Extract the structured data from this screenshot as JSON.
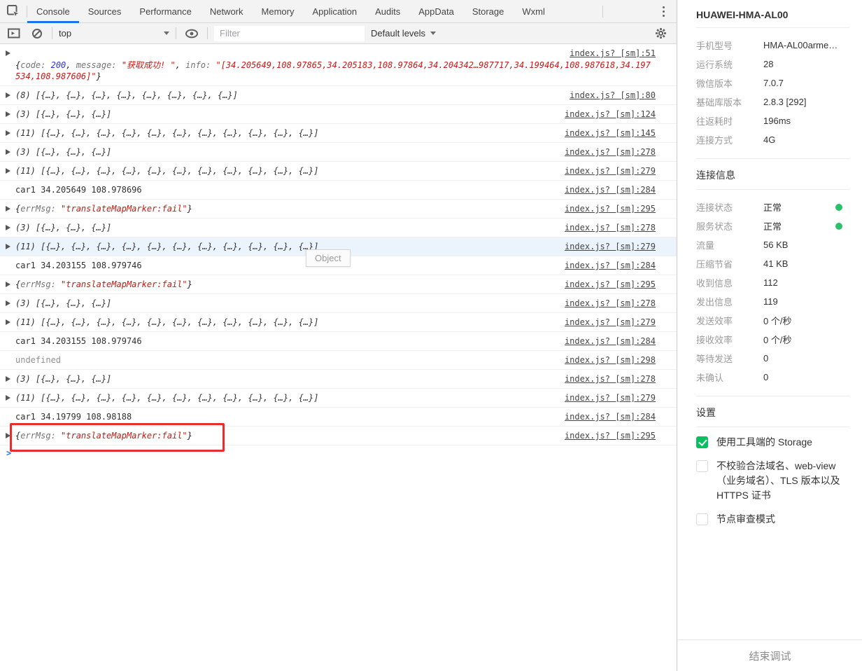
{
  "colors": {
    "accent_blue": "#1a73e8",
    "link": "#454545",
    "string_red": "#c41a16",
    "number_blue": "#2b33cc",
    "highlight_row": "#ebf3fc",
    "annotation_red": "#e52e2e",
    "status_green": "#2bc06a",
    "checkbox_green": "#07c160",
    "toolbar_bg": "#f3f3f3"
  },
  "tabs": {
    "items": [
      "Console",
      "Sources",
      "Performance",
      "Network",
      "Memory",
      "Application",
      "Audits",
      "AppData",
      "Storage",
      "Wxml"
    ],
    "active": "Console"
  },
  "toolbar": {
    "context_label": "top",
    "filter_placeholder": "Filter",
    "levels_label": "Default levels"
  },
  "icons": [
    "inspect-icon",
    "kebab-menu-icon",
    "drawer-toggle-icon",
    "clear-console-icon",
    "live-expression-eye-icon",
    "gear-icon",
    "chevron-down-icon"
  ],
  "console": {
    "tooltip": "Object",
    "prompt": ">",
    "rows": [
      {
        "kind": "object",
        "wrap": true,
        "link": "index.js? [sm]:51",
        "segments": [
          {
            "t": "{",
            "s": "b"
          },
          {
            "t": "code: ",
            "s": "k"
          },
          {
            "t": "200",
            "s": "n"
          },
          {
            "t": ", ",
            "s": "b"
          },
          {
            "t": "message: ",
            "s": "k"
          },
          {
            "t": "\"获取成功! \"",
            "s": "s"
          },
          {
            "t": ", ",
            "s": "b"
          },
          {
            "t": "info: ",
            "s": "k"
          },
          {
            "t": "\"[34.205649,108.97865,34.205183,108.97864,34.204342…987717,34.199464,108.987618,34.197534,108.987606]\"",
            "s": "s"
          },
          {
            "t": "}",
            "s": "b"
          }
        ]
      },
      {
        "kind": "preview",
        "link": "index.js? [sm]:80",
        "text": "(8) [{…}, {…}, {…}, {…}, {…}, {…}, {…}, {…}]"
      },
      {
        "kind": "preview",
        "link": "index.js? [sm]:124",
        "text": "(3) [{…}, {…}, {…}]"
      },
      {
        "kind": "preview",
        "link": "index.js? [sm]:145",
        "text": "(11) [{…}, {…}, {…}, {…}, {…}, {…}, {…}, {…}, {…}, {…}, {…}]"
      },
      {
        "kind": "preview",
        "link": "index.js? [sm]:278",
        "text": "(3) [{…}, {…}, {…}]"
      },
      {
        "kind": "preview",
        "link": "index.js? [sm]:279",
        "text": "(11) [{…}, {…}, {…}, {…}, {…}, {…}, {…}, {…}, {…}, {…}, {…}]"
      },
      {
        "kind": "log",
        "link": "index.js? [sm]:284",
        "text": "car1 34.205649 108.978696"
      },
      {
        "kind": "object",
        "link": "index.js? [sm]:295",
        "segments": [
          {
            "t": "{",
            "s": "b"
          },
          {
            "t": "errMsg: ",
            "s": "k"
          },
          {
            "t": "\"translateMapMarker:fail\"",
            "s": "s"
          },
          {
            "t": "}",
            "s": "b"
          }
        ]
      },
      {
        "kind": "preview",
        "link": "index.js? [sm]:278",
        "text": "(3) [{…}, {…}, {…}]"
      },
      {
        "kind": "preview",
        "link": "index.js? [sm]:279",
        "highlight": true,
        "text": "(11) [{…}, {…}, {…}, {…}, {…}, {…}, {…}, {…}, {…}, {…}, {…}]"
      },
      {
        "kind": "log",
        "link": "index.js? [sm]:284",
        "text": "car1 34.203155 108.979746"
      },
      {
        "kind": "object",
        "link": "index.js? [sm]:295",
        "segments": [
          {
            "t": "{",
            "s": "b"
          },
          {
            "t": "errMsg: ",
            "s": "k"
          },
          {
            "t": "\"translateMapMarker:fail\"",
            "s": "s"
          },
          {
            "t": "}",
            "s": "b"
          }
        ]
      },
      {
        "kind": "preview",
        "link": "index.js? [sm]:278",
        "text": "(3) [{…}, {…}, {…}]"
      },
      {
        "kind": "preview",
        "link": "index.js? [sm]:279",
        "text": "(11) [{…}, {…}, {…}, {…}, {…}, {…}, {…}, {…}, {…}, {…}, {…}]"
      },
      {
        "kind": "log",
        "link": "index.js? [sm]:284",
        "text": "car1 34.203155 108.979746"
      },
      {
        "kind": "undefined",
        "link": "index.js? [sm]:298",
        "text": "undefined"
      },
      {
        "kind": "preview",
        "link": "index.js? [sm]:278",
        "text": "(3) [{…}, {…}, {…}]"
      },
      {
        "kind": "preview",
        "link": "index.js? [sm]:279",
        "text": "(11) [{…}, {…}, {…}, {…}, {…}, {…}, {…}, {…}, {…}, {…}, {…}]"
      },
      {
        "kind": "log",
        "link": "index.js? [sm]:284",
        "text": "car1 34.19799 108.98188"
      },
      {
        "kind": "object",
        "link": "index.js? [sm]:295",
        "boxed": true,
        "segments": [
          {
            "t": "{",
            "s": "b"
          },
          {
            "t": "errMsg: ",
            "s": "k"
          },
          {
            "t": "\"translateMapMarker:fail\"",
            "s": "s"
          },
          {
            "t": "}",
            "s": "b"
          }
        ]
      }
    ]
  },
  "device": {
    "title": "HUAWEI-HMA-AL00",
    "rows": [
      {
        "label": "手机型号",
        "value": "HMA-AL00arme…"
      },
      {
        "label": "运行系统",
        "value": "28"
      },
      {
        "label": "微信版本",
        "value": "7.0.7"
      },
      {
        "label": "基础库版本",
        "value": "2.8.3 [292]"
      },
      {
        "label": "往返耗时",
        "value": "196ms"
      },
      {
        "label": "连接方式",
        "value": "4G"
      }
    ]
  },
  "connection": {
    "header": "连接信息",
    "rows": [
      {
        "label": "连接状态",
        "value": "正常",
        "dot": true
      },
      {
        "label": "服务状态",
        "value": "正常",
        "dot": true
      },
      {
        "label": "流量",
        "value": "56 KB"
      },
      {
        "label": "压缩节省",
        "value": "41 KB"
      },
      {
        "label": "收到信息",
        "value": "112"
      },
      {
        "label": "发出信息",
        "value": "119"
      },
      {
        "label": "发送效率",
        "value": "0 个/秒"
      },
      {
        "label": "接收效率",
        "value": "0 个/秒"
      },
      {
        "label": "等待发送",
        "value": "0"
      },
      {
        "label": "未确认",
        "value": "0"
      }
    ]
  },
  "settings": {
    "header": "设置",
    "options": [
      {
        "label": "使用工具端的 Storage",
        "checked": true
      },
      {
        "label": "不校验合法域名、web-view（业务域名）、TLS 版本以及 HTTPS 证书",
        "checked": false
      },
      {
        "label": "节点审查模式",
        "checked": false
      }
    ]
  },
  "footer": {
    "end_debug_label": "结束调试"
  }
}
